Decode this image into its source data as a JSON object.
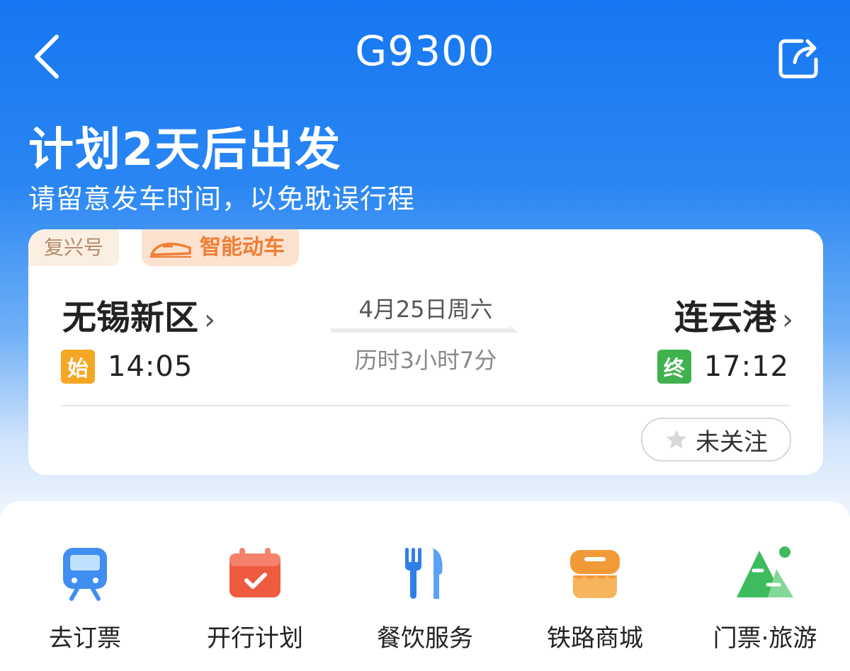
{
  "header": {
    "title": "G9300",
    "back_icon": "chevron-left-icon",
    "share_icon": "share-icon"
  },
  "notice": {
    "headline": "计划2天后出发",
    "subline": "请留意发车时间，以免耽误行程"
  },
  "train": {
    "brand_tag": "复兴号",
    "type_tag": "智能动车",
    "from": {
      "station": "无锡新区",
      "badge": "始",
      "time": "14:05"
    },
    "to": {
      "station": "连云港",
      "badge": "终",
      "time": "17:12"
    },
    "date": "4月25日周六",
    "duration": "历时3小时7分",
    "follow_label": "未关注"
  },
  "services": [
    {
      "label": "去订票",
      "icon": "train-icon"
    },
    {
      "label": "开行计划",
      "icon": "calendar-icon"
    },
    {
      "label": "餐饮服务",
      "icon": "utensils-icon"
    },
    {
      "label": "铁路商城",
      "icon": "store-icon"
    },
    {
      "label": "门票·旅游",
      "icon": "mountain-icon"
    }
  ],
  "colors": {
    "primary_blue": "#1677f2",
    "start_badge": "#f5a623",
    "end_badge": "#3fb24e",
    "tag_orange": "#f07d36"
  }
}
